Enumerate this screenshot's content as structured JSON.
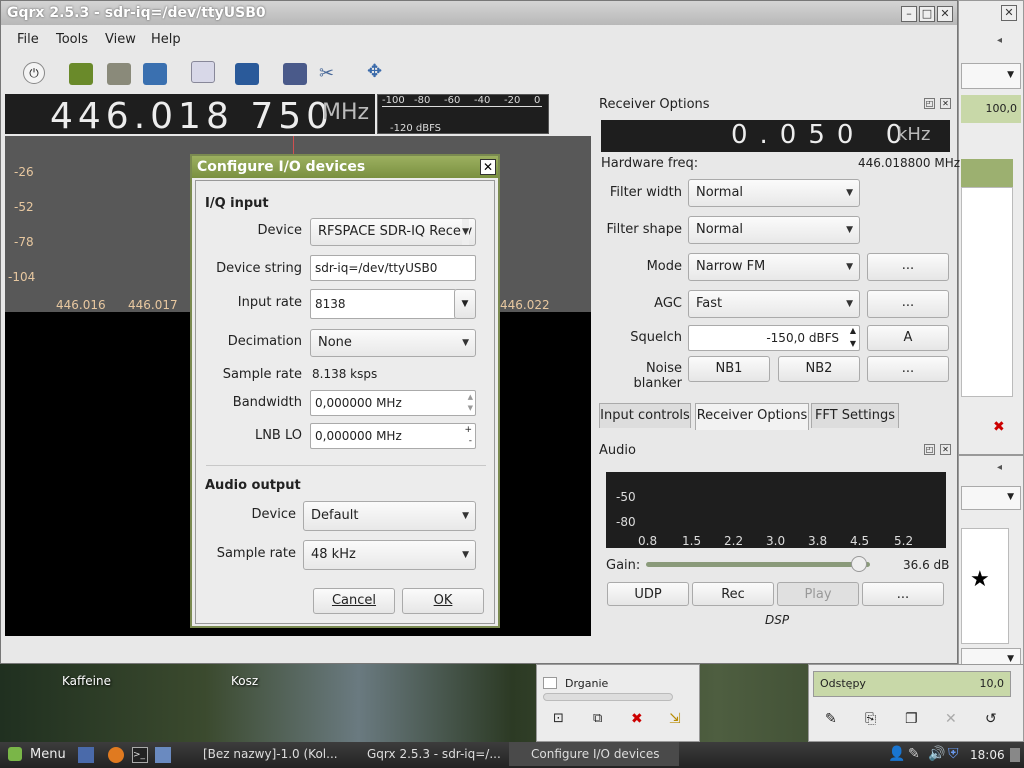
{
  "desktop": {
    "icons": [
      "Kaffeine",
      "Kosz"
    ]
  },
  "bg_right": {
    "value_field": "100,0",
    "list_item": "Drganie",
    "field_label": "Odstępy",
    "field_value": "10,0"
  },
  "window": {
    "title": "Gqrx 2.5.3 - sdr-iq=/dev/ttyUSB0",
    "menu": [
      "File",
      "Tools",
      "View",
      "Help"
    ]
  },
  "frequency": {
    "digits": "446.018 750",
    "unit": "MHz"
  },
  "smeter": {
    "scale": [
      "-100",
      "-80",
      "-60",
      "-40",
      "-20",
      "0"
    ],
    "reading": "-120 dBFS"
  },
  "spectrum": {
    "db_labels": [
      "-26",
      "-52",
      "-78",
      "-104"
    ],
    "freq_labels": [
      "446.016",
      "446.017",
      "446.022"
    ]
  },
  "receiver": {
    "title": "Receiver Options",
    "offset_digits": "0.050 0",
    "offset_unit": "kHz",
    "hw_freq_label": "Hardware freq:",
    "hw_freq_value": "446.018800 MHz",
    "filter_width_label": "Filter width",
    "filter_width_value": "Normal",
    "filter_shape_label": "Filter shape",
    "filter_shape_value": "Normal",
    "mode_label": "Mode",
    "mode_value": "Narrow FM",
    "agc_label": "AGC",
    "agc_value": "Fast",
    "squelch_label": "Squelch",
    "squelch_value": "-150,0 dBFS",
    "squelch_btn": "A",
    "nb_label": "Noise blanker",
    "nb1": "NB1",
    "nb2": "NB2",
    "more": "...",
    "tabs": [
      "Input controls",
      "Receiver Options",
      "FFT Settings"
    ]
  },
  "audio": {
    "title": "Audio",
    "db_labels": [
      "-50",
      "-80"
    ],
    "freq_labels": [
      "0.8",
      "1.5",
      "2.2",
      "3.0",
      "3.8",
      "4.5",
      "5.2"
    ],
    "gain_label": "Gain:",
    "gain_value": "36.6 dB",
    "gain_level": 0.95,
    "buttons": [
      "UDP",
      "Rec",
      "Play",
      "..."
    ],
    "dsp_label": "DSP"
  },
  "dialog": {
    "title": "Configure I/O devices",
    "iq_section": "I/Q input",
    "device_label": "Device",
    "device_value": "RFSPACE SDR-IQ Receiv",
    "devstr_label": "Device string",
    "devstr_value": "sdr-iq=/dev/ttyUSB0",
    "rate_label": "Input rate",
    "rate_value": "8138",
    "decim_label": "Decimation",
    "decim_value": "None",
    "srate_label": "Sample rate",
    "srate_value": "8.138 ksps",
    "bw_label": "Bandwidth",
    "bw_value": "0,000000 MHz",
    "lnb_label": "LNB LO",
    "lnb_value": "0,000000 MHz",
    "audio_section": "Audio output",
    "adev_label": "Device",
    "adev_value": "Default",
    "asrate_label": "Sample rate",
    "asrate_value": "48 kHz",
    "cancel": "Cancel",
    "ok": "OK"
  },
  "taskbar": {
    "menu_label": "Menu",
    "tasks": [
      "[Bez nazwy]-1.0 (Kol...",
      "Gqrx 2.5.3 - sdr-iq=/...",
      "Configure I/O devices"
    ],
    "clock": "18:06"
  }
}
